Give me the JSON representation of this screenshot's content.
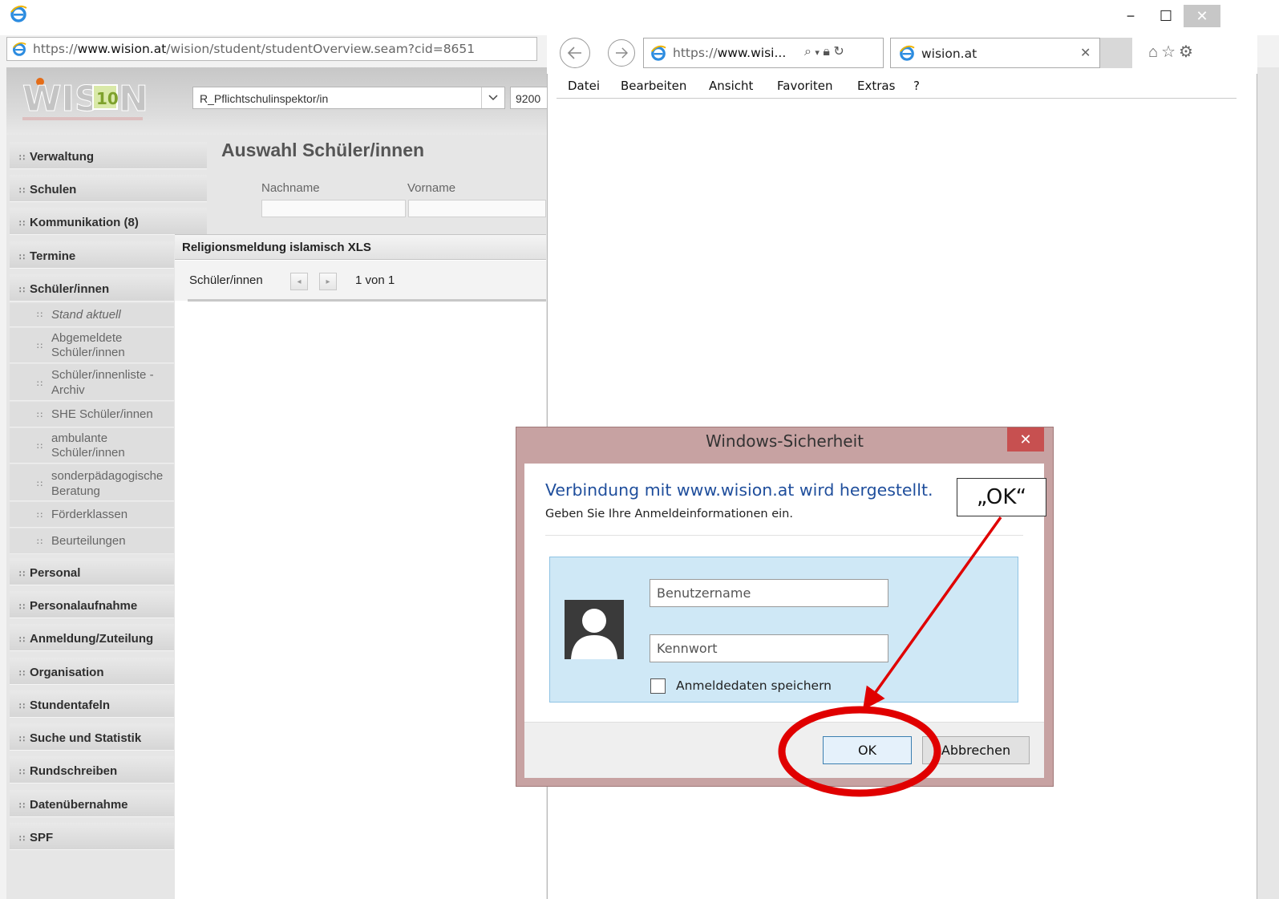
{
  "background_window": {
    "address_url_prefix": "https://",
    "address_url_host": "www.wision.at",
    "address_url_path": "/wision/student/studentOverview.seam?cid=8651",
    "role_select_value": "R_Pflichtschulinspektor/in",
    "number_field_value": "9200",
    "page_title": "Auswahl Schüler/innen",
    "search_labels": {
      "lastname": "Nachname",
      "firstname": "Vorname"
    },
    "sidebar": {
      "main_top": [
        {
          "label": "Verwaltung"
        },
        {
          "label": "Schulen"
        },
        {
          "label": "Kommunikation (8)"
        },
        {
          "label": "Termine"
        },
        {
          "label": "Schüler/innen"
        }
      ],
      "sub_items": [
        {
          "line1": "Stand aktuell",
          "line2": ""
        },
        {
          "line1": "Abgemeldete",
          "line2": "Schüler/innen"
        },
        {
          "line1": "Schüler/innenliste -",
          "line2": "Archiv"
        },
        {
          "line1": "SHE Schüler/innen",
          "line2": ""
        },
        {
          "line1": "ambulante",
          "line2": "Schüler/innen"
        },
        {
          "line1": "sonderpädagogische",
          "line2": "Beratung"
        },
        {
          "line1": "Förderklassen",
          "line2": ""
        },
        {
          "line1": "Beurteilungen",
          "line2": ""
        }
      ],
      "main_bottom": [
        {
          "label": "Personal"
        },
        {
          "label": "Personalaufnahme"
        },
        {
          "label": "Anmeldung/Zuteilung"
        },
        {
          "label": "Organisation"
        },
        {
          "label": "Stundentafeln"
        },
        {
          "label": "Suche und Statistik"
        },
        {
          "label": "Rundschreiben"
        },
        {
          "label": "Datenübernahme"
        },
        {
          "label": "SPF"
        }
      ]
    },
    "xls_panel": {
      "title": "Religionsmeldung islamisch XLS",
      "label": "Schüler/innen",
      "pager": "1 von 1"
    }
  },
  "foreground_window": {
    "address_url_prefix": "https://",
    "address_url_host": "www.wisi...",
    "tab_title": "wision.at",
    "menu": [
      "Datei",
      "Bearbeiten",
      "Ansicht",
      "Favoriten",
      "Extras",
      "?"
    ]
  },
  "dialog": {
    "title": "Windows-Sicherheit",
    "heading": "Verbindung mit www.wision.at wird hergestellt.",
    "subheading": "Geben Sie Ihre Anmeldeinformationen ein.",
    "username_placeholder": "Benutzername",
    "password_placeholder": "Kennwort",
    "remember_label": "Anmeldedaten speichern",
    "ok_label": "OK",
    "cancel_label": "Abbrechen"
  },
  "annotation": {
    "callout_text": "„OK“",
    "color": "#e00000"
  }
}
